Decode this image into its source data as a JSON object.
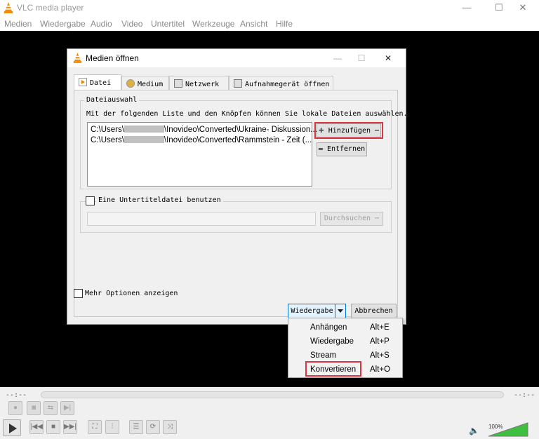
{
  "app": {
    "title": "VLC media player",
    "window_buttons": [
      "—",
      "☐",
      "✕"
    ]
  },
  "menu": [
    "Medien",
    "Wiedergabe",
    "Audio",
    "Video",
    "Untertitel",
    "Werkzeuge",
    "Ansicht",
    "Hilfe"
  ],
  "player": {
    "time_elapsed": "--:--",
    "time_total": "--:--",
    "volume": "100%",
    "volume_level": 1.0
  },
  "dialog": {
    "title": "Medien öffnen",
    "tabs": [
      "Datei",
      "Medium",
      "Netzwerk",
      "Aufnahmegerät öffnen"
    ],
    "file_section": {
      "label": "Dateiauswahl",
      "description": "Mit der folgenden Liste und den Knöpfen können Sie lokale Dateien auswählen.",
      "files": [
        {
          "prefix": "C:\\Users\\",
          "suffix": "\\Inovideo\\Converted\\Ukraine- Diskussion..."
        },
        {
          "prefix": "C:\\Users\\",
          "suffix": "\\Inovideo\\Converted\\Rammstein - Zeit (..."
        }
      ],
      "add_button": "Hinzufügen",
      "remove_button": "Entfernen"
    },
    "subtitle_section": {
      "checkbox_label": "Eine Untertiteldatei benutzen",
      "path_value": "",
      "browse_button": "Durchsuchen"
    },
    "more_options": "Mehr Optionen anzeigen",
    "play_button": "Wiedergabe",
    "cancel_button": "Abbrechen"
  },
  "dropdown": {
    "items": [
      {
        "label": "Anhängen",
        "shortcut": "Alt+E"
      },
      {
        "label": "Wiedergabe",
        "shortcut": "Alt+P"
      },
      {
        "label": "Stream",
        "shortcut": "Alt+S"
      },
      {
        "label": "Konvertieren",
        "shortcut": "Alt+O"
      }
    ]
  },
  "colors": {
    "highlight": "#d9363e",
    "vlc_orange": "#f28c00",
    "volume_green": "#3fbf3f"
  }
}
